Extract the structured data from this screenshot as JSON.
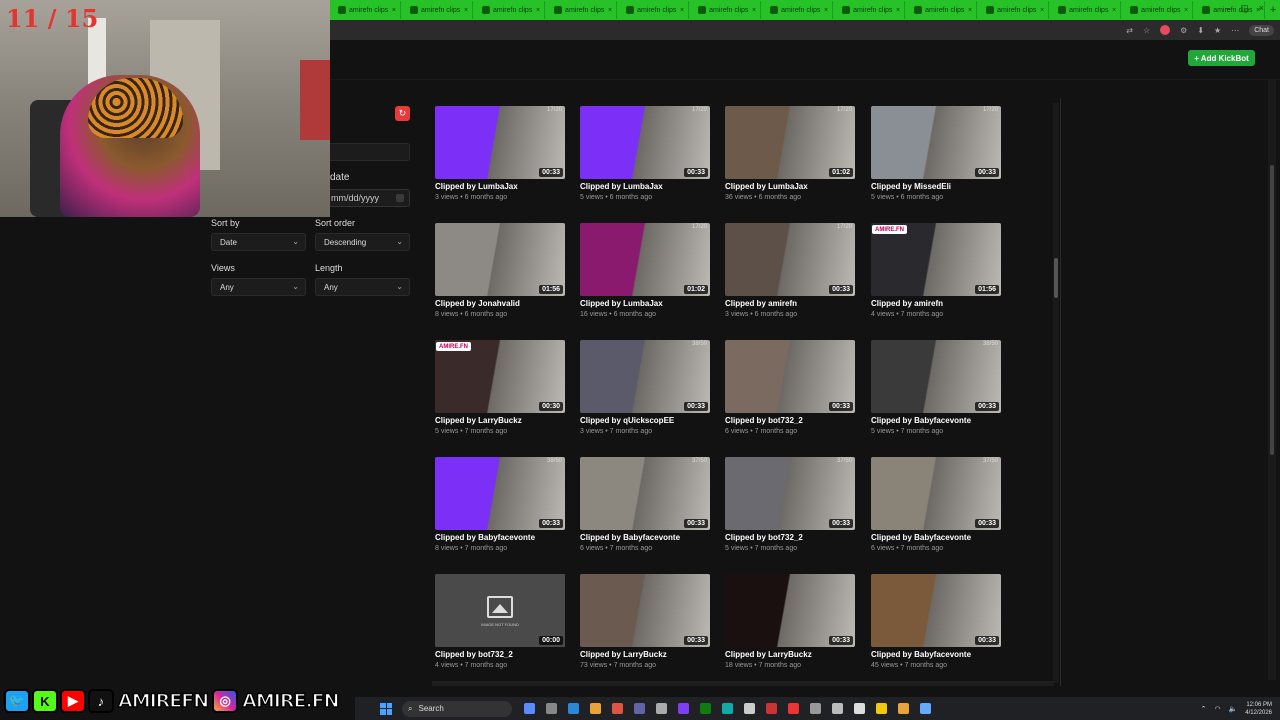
{
  "overlay": {
    "counter": "11 / 15",
    "social_handles": [
      "AMIREFN",
      "AMIRE.FN"
    ]
  },
  "browser": {
    "tabs": [
      "amirefn clips",
      "amirefn clips",
      "amirefn clips",
      "amirefn clips",
      "amirefn clips",
      "amirefn clips",
      "amirefn clips",
      "amirefn clips",
      "amirefn clips",
      "amirefn clips",
      "amirefn clips",
      "amirefn clips",
      "amirefn clips"
    ],
    "new_tab": "+",
    "chat_label": "Chat"
  },
  "header": {
    "add_kickbot_label": "+ Add KickBot"
  },
  "filters": {
    "date_label": "date",
    "date_placeholder": "mm/dd/yyyy",
    "sort_by_label": "Sort by",
    "sort_by_value": "Date",
    "sort_order_label": "Sort order",
    "sort_order_value": "Descending",
    "views_label": "Views",
    "views_value": "Any",
    "length_label": "Length",
    "length_value": "Any"
  },
  "clips": [
    {
      "title": "Clipped by LumbaJax",
      "meta": "3 views • 6 months ago",
      "duration": "00:33",
      "tag": "17/20",
      "badge": "",
      "color": "#7b2ff7"
    },
    {
      "title": "Clipped by LumbaJax",
      "meta": "5 views • 6 months ago",
      "duration": "00:33",
      "tag": "17/20",
      "badge": "",
      "color": "#7b2ff7"
    },
    {
      "title": "Clipped by LumbaJax",
      "meta": "36 views • 6 months ago",
      "duration": "01:02",
      "tag": "17/20",
      "badge": "",
      "color": "#6e5a4a"
    },
    {
      "title": "Clipped by MissedEli",
      "meta": "5 views • 6 months ago",
      "duration": "00:33",
      "tag": "17/20",
      "badge": "",
      "color": "#8a8f96"
    },
    {
      "title": "Clipped by Jonahvalid",
      "meta": "8 views • 6 months ago",
      "duration": "01:56",
      "tag": "",
      "badge": "",
      "color": "#8d8a86"
    },
    {
      "title": "Clipped by LumbaJax",
      "meta": "16 views • 6 months ago",
      "duration": "01:02",
      "tag": "17/20",
      "badge": "",
      "color": "#8a1a6e"
    },
    {
      "title": "Clipped by amirefn",
      "meta": "3 views • 6 months ago",
      "duration": "00:33",
      "tag": "17/20",
      "badge": "",
      "color": "#5c5048"
    },
    {
      "title": "Clipped by amirefn",
      "meta": "4 views • 7 months ago",
      "duration": "01:56",
      "tag": "",
      "badge": "AMIRE.FN",
      "color": "#2a2a2e"
    },
    {
      "title": "Clipped by LarryBuckz",
      "meta": "5 views • 7 months ago",
      "duration": "00:30",
      "tag": "",
      "badge": "AMIRE.FN",
      "color": "#3a2a2a"
    },
    {
      "title": "Clipped by qUickscopEE",
      "meta": "3 views • 7 months ago",
      "duration": "00:33",
      "tag": "38/50",
      "badge": "",
      "color": "#5a5a6a"
    },
    {
      "title": "Clipped by bot732_2",
      "meta": "6 views • 7 months ago",
      "duration": "00:33",
      "tag": "",
      "badge": "",
      "color": "#7a6a60"
    },
    {
      "title": "Clipped by Babyfacevonte",
      "meta": "5 views • 7 months ago",
      "duration": "00:33",
      "tag": "38/50",
      "badge": "",
      "color": "#3a3a3a"
    },
    {
      "title": "Clipped by Babyfacevonte",
      "meta": "8 views • 7 months ago",
      "duration": "00:33",
      "tag": "38/50",
      "badge": "",
      "color": "#7b2ff7"
    },
    {
      "title": "Clipped by Babyfacevonte",
      "meta": "6 views • 7 months ago",
      "duration": "00:33",
      "tag": "37/50",
      "badge": "",
      "color": "#8c8880"
    },
    {
      "title": "Clipped by bot732_2",
      "meta": "5 views • 7 months ago",
      "duration": "00:33",
      "tag": "37/50",
      "badge": "",
      "color": "#6a6a70"
    },
    {
      "title": "Clipped by Babyfacevonte",
      "meta": "6 views • 7 months ago",
      "duration": "00:33",
      "tag": "37/50",
      "badge": "",
      "color": "#8a8478"
    },
    {
      "title": "Clipped by bot732_2",
      "meta": "4 views • 7 months ago",
      "duration": "00:00",
      "tag": "",
      "badge": "",
      "color": "#4a4a4a",
      "not_found": "IMAGE NOT FOUND"
    },
    {
      "title": "Clipped by LarryBuckz",
      "meta": "73 views • 7 months ago",
      "duration": "00:33",
      "tag": "",
      "badge": "",
      "color": "#6a5a50"
    },
    {
      "title": "Clipped by LarryBuckz",
      "meta": "18 views • 7 months ago",
      "duration": "00:33",
      "tag": "",
      "badge": "",
      "color": "#1a1010"
    },
    {
      "title": "Clipped by Babyfacevonte",
      "meta": "45 views • 7 months ago",
      "duration": "00:33",
      "tag": "",
      "badge": "",
      "color": "#7a5a3a"
    }
  ],
  "taskbar": {
    "search_placeholder": "Search",
    "time": "12:06 PM",
    "date": "4/12/2026"
  }
}
